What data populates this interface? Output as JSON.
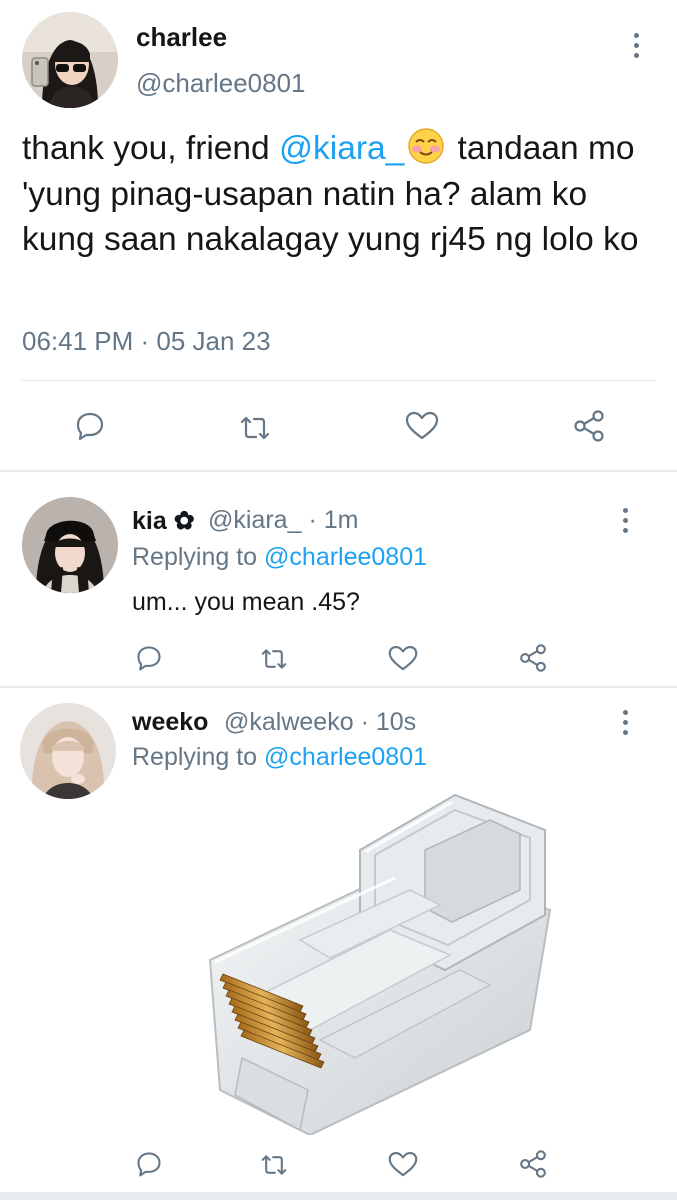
{
  "main_tweet": {
    "display_name": "charlee",
    "handle": "@charlee0801",
    "text_before": "thank you, friend ",
    "mention": "@kiara_",
    "text_after": " tandaan mo 'yung pinag-usapan natin ha? alam ko kung saan nakalagay yung rj45 ng lolo ko",
    "emoji": "smiling-face-with-blush",
    "timestamp": "06:41 PM · 05 Jan 23"
  },
  "replies": [
    {
      "display_name": "kia",
      "name_badge": "✿",
      "handle": "@kiara_",
      "time": "· 1m",
      "replying_label": "Replying to",
      "replying_to": "@charlee0801",
      "text": "um... you mean .45?"
    },
    {
      "display_name": "weeko",
      "handle": "@kalweeko",
      "time": "· 10s",
      "replying_label": "Replying to",
      "replying_to": "@charlee0801",
      "image": "rj45-connector"
    }
  ],
  "actions": [
    "reply-icon",
    "retweet-icon",
    "like-icon",
    "share-icon"
  ],
  "colors": {
    "link": "#1da1f2",
    "secondary_text": "#657786",
    "icon": "#657786",
    "divider": "#e6ecf0"
  }
}
